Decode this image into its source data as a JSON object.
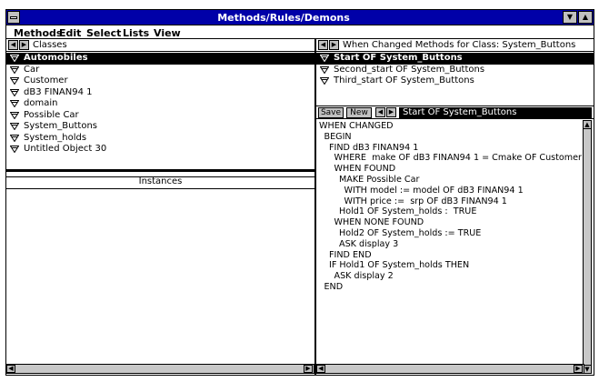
{
  "window": {
    "title": "Methods/Rules/Demons"
  },
  "menu": [
    "Methods",
    "Edit",
    "Select",
    "Lists",
    "View"
  ],
  "classes_pane": {
    "header": "Classes",
    "items": [
      {
        "label": "Automobiles",
        "selected": true
      },
      {
        "label": "Car",
        "selected": false
      },
      {
        "label": "Customer",
        "selected": false
      },
      {
        "label": "dB3 FINAN94 1",
        "selected": false
      },
      {
        "label": "domain",
        "selected": false
      },
      {
        "label": "Possible Car",
        "selected": false
      },
      {
        "label": "System_Buttons",
        "selected": false
      },
      {
        "label": "System_holds",
        "selected": false
      },
      {
        "label": "Untitled Object 30",
        "selected": false
      }
    ]
  },
  "instances_pane": {
    "header": "Instances"
  },
  "methods_pane": {
    "header": "When Changed Methods for Class: System_Buttons",
    "items": [
      {
        "label": "Start OF System_Buttons",
        "selected": true
      },
      {
        "label": "Second_start OF System_Buttons",
        "selected": false
      },
      {
        "label": "Third_start OF System_Buttons",
        "selected": false
      }
    ]
  },
  "editor": {
    "save_label": "Save",
    "new_label": "New",
    "current_rule": "Start OF System_Buttons",
    "code_lines": [
      {
        "indent": 0,
        "text": "WHEN CHANGED"
      },
      {
        "indent": 1,
        "text": "BEGIN"
      },
      {
        "indent": 2,
        "text": "FIND dB3 FINAN94 1"
      },
      {
        "indent": 3,
        "text": "WHERE  make OF dB3 FINAN94 1 = Cmake OF Customer"
      },
      {
        "indent": 3,
        "text": "WHEN FOUND"
      },
      {
        "indent": 4,
        "text": "MAKE Possible Car"
      },
      {
        "indent": 5,
        "text": "WITH model := model OF dB3 FINAN94 1"
      },
      {
        "indent": 5,
        "text": "WITH price :=  srp OF dB3 FINAN94 1"
      },
      {
        "indent": 4,
        "text": "Hold1 OF System_holds :  TRUE"
      },
      {
        "indent": 3,
        "text": "WHEN NONE FOUND"
      },
      {
        "indent": 4,
        "text": "Hold2 OF System_holds := TRUE"
      },
      {
        "indent": 4,
        "text": "ASK display 3"
      },
      {
        "indent": 2,
        "text": "FIND END"
      },
      {
        "indent": 2,
        "text": "IF Hold1 OF System_holds THEN"
      },
      {
        "indent": 3,
        "text": "ASK display 2"
      },
      {
        "indent": 1,
        "text": "END"
      }
    ]
  }
}
